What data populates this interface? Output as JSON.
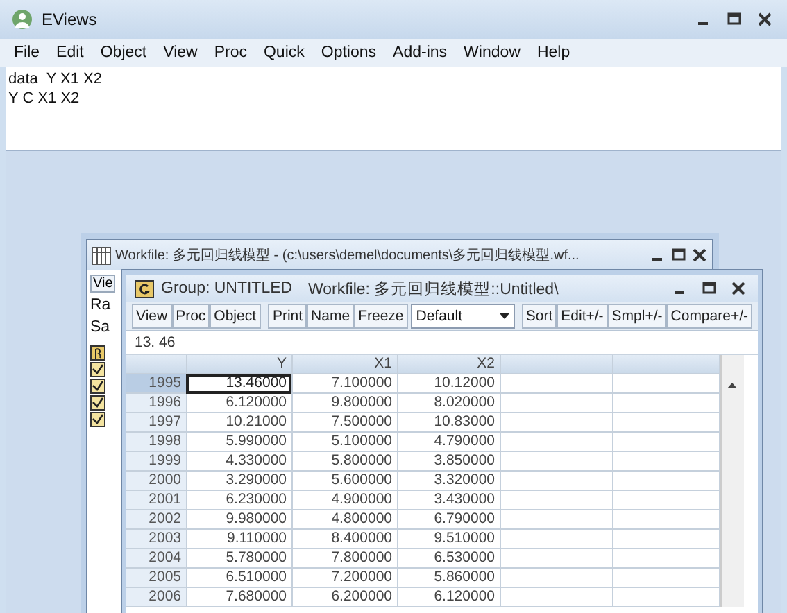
{
  "window": {
    "title": "EViews"
  },
  "menu": [
    "File",
    "Edit",
    "Object",
    "View",
    "Proc",
    "Quick",
    "Options",
    "Add-ins",
    "Window",
    "Help"
  ],
  "command_lines": [
    "data  Y X1 X2",
    "Y C X1 X2"
  ],
  "workfile_window": {
    "title": "Workfile: 多元回归线模型 - (c:\\users\\demel\\documents\\多元回归线模型.wf...",
    "toolbar": [
      "Vie"
    ],
    "info": [
      "Ra",
      "Sa"
    ],
    "objects": [
      {
        "kind": "coefficient"
      },
      {
        "kind": "series"
      },
      {
        "kind": "series"
      },
      {
        "kind": "series"
      },
      {
        "kind": "series"
      }
    ]
  },
  "group_window": {
    "title": "Group: UNTITLED",
    "workfile": "Workfile: 多元回归线模型::Untitled\\",
    "toolbar_left": [
      "View",
      "Proc",
      "Object"
    ],
    "toolbar_mid": [
      "Print",
      "Name",
      "Freeze"
    ],
    "dropdown": "Default",
    "toolbar_right": [
      "Sort",
      "Edit+/-",
      "Smpl+/-",
      "Compare+/-"
    ],
    "edit_line": "13. 46",
    "columns": [
      "Y",
      "X1",
      "X2"
    ],
    "rows": [
      {
        "label": "1995",
        "cells": [
          "13.46000",
          "7.100000",
          "10.12000"
        ],
        "selected": true
      },
      {
        "label": "1996",
        "cells": [
          "6.120000",
          "9.800000",
          "8.020000"
        ],
        "selected": false
      },
      {
        "label": "1997",
        "cells": [
          "10.21000",
          "7.500000",
          "10.83000"
        ],
        "selected": false
      },
      {
        "label": "1998",
        "cells": [
          "5.990000",
          "5.100000",
          "4.790000"
        ],
        "selected": false
      },
      {
        "label": "1999",
        "cells": [
          "4.330000",
          "5.800000",
          "3.850000"
        ],
        "selected": false
      },
      {
        "label": "2000",
        "cells": [
          "3.290000",
          "5.600000",
          "3.320000"
        ],
        "selected": false
      },
      {
        "label": "2001",
        "cells": [
          "6.230000",
          "4.900000",
          "3.430000"
        ],
        "selected": false
      },
      {
        "label": "2002",
        "cells": [
          "9.980000",
          "4.800000",
          "6.790000"
        ],
        "selected": false
      },
      {
        "label": "2003",
        "cells": [
          "9.110000",
          "8.400000",
          "9.510000"
        ],
        "selected": false
      },
      {
        "label": "2004",
        "cells": [
          "5.780000",
          "7.800000",
          "6.530000"
        ],
        "selected": false
      },
      {
        "label": "2005",
        "cells": [
          "6.510000",
          "7.200000",
          "5.860000"
        ],
        "selected": false
      },
      {
        "label": "2006",
        "cells": [
          "7.680000",
          "6.200000",
          "6.120000"
        ],
        "selected": false
      }
    ]
  }
}
